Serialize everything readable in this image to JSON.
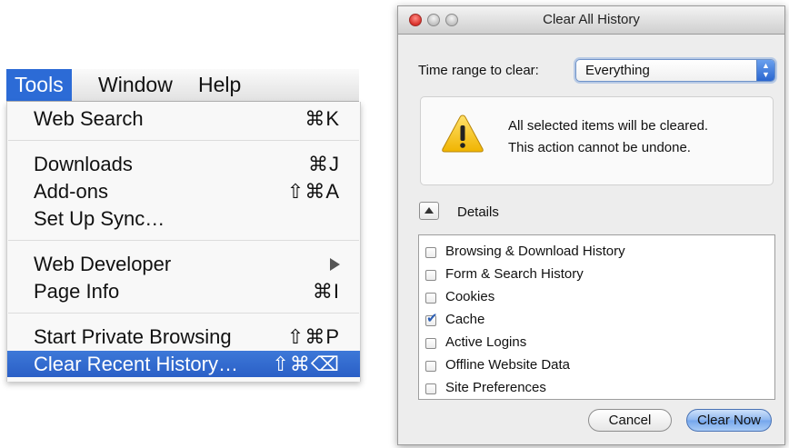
{
  "tools_menu": {
    "menubar": {
      "tools": "Tools",
      "window": "Window",
      "help": "Help"
    },
    "items": {
      "web_search": {
        "label": "Web Search",
        "shortcut": "⌘K"
      },
      "downloads": {
        "label": "Downloads",
        "shortcut": "⌘J"
      },
      "addons": {
        "label": "Add-ons",
        "shortcut": "⇧⌘A"
      },
      "set_up_sync": {
        "label": "Set Up Sync…"
      },
      "web_developer": {
        "label": "Web Developer"
      },
      "page_info": {
        "label": "Page Info",
        "shortcut": "⌘I"
      },
      "private_browsing": {
        "label": "Start Private Browsing",
        "shortcut": "⇧⌘P"
      },
      "clear_recent": {
        "label": "Clear Recent History…",
        "shortcut": "⇧⌘⌫"
      }
    }
  },
  "dialog": {
    "title": "Clear All History",
    "time_range": {
      "label": "Time range to clear:",
      "value": "Everything"
    },
    "warning": {
      "line1": "All selected items will be cleared.",
      "line2": "This action cannot be undone."
    },
    "details_label": "Details",
    "options": [
      {
        "label": "Browsing & Download History",
        "checked": false
      },
      {
        "label": "Form & Search History",
        "checked": false
      },
      {
        "label": "Cookies",
        "checked": false
      },
      {
        "label": "Cache",
        "checked": true
      },
      {
        "label": "Active Logins",
        "checked": false
      },
      {
        "label": "Offline Website Data",
        "checked": false
      },
      {
        "label": "Site Preferences",
        "checked": false
      }
    ],
    "buttons": {
      "cancel": "Cancel",
      "clear_now": "Clear Now"
    }
  },
  "icons": {
    "warning": "warning-triangle-icon",
    "submenu": "chevron-right-icon",
    "disclosure": "disclosure-up-icon",
    "checkmark": "checkmark-icon"
  },
  "colors": {
    "menu_highlight": "#2c6bd6",
    "default_button": "#8db6ef",
    "warning_yellow": "#f5c518"
  }
}
